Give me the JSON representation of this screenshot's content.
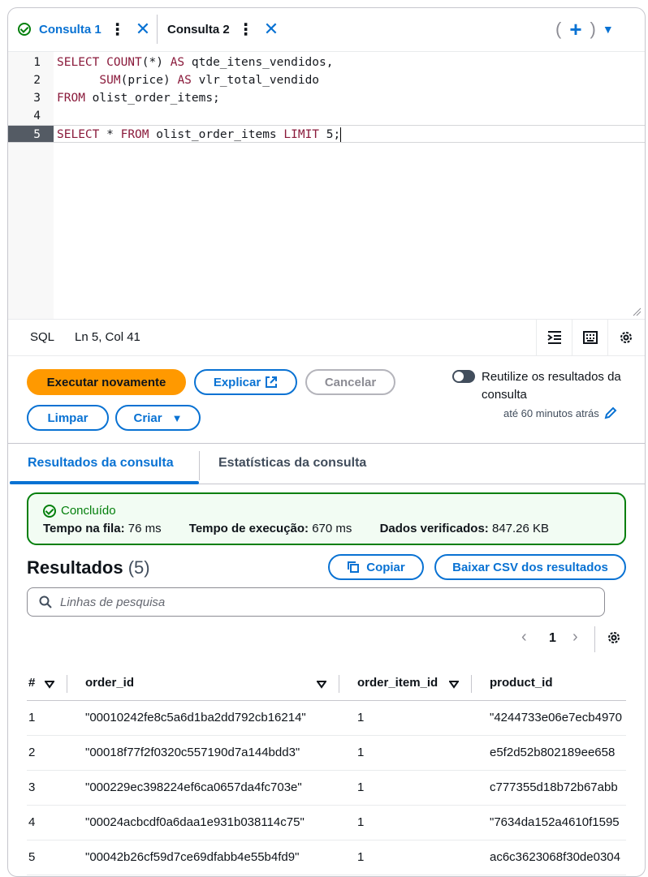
{
  "tabs": [
    {
      "label": "Consulta 1",
      "active": true,
      "status": "success"
    },
    {
      "label": "Consulta 2",
      "active": false
    }
  ],
  "tabs_add": {
    "open": "(",
    "plus": "+",
    "close": ")",
    "caret": "▼"
  },
  "editor": {
    "lines": [
      {
        "num": "1",
        "segments": [
          {
            "t": "SELECT ",
            "kw": true
          },
          {
            "t": "COUNT",
            "kw": true
          },
          {
            "t": "(*) ",
            "kw": false
          },
          {
            "t": "AS",
            "kw": true
          },
          {
            "t": " qtde_itens_vendidos,",
            "kw": false
          }
        ]
      },
      {
        "num": "2",
        "segments": [
          {
            "t": "      ",
            "kw": false
          },
          {
            "t": "SUM",
            "kw": true
          },
          {
            "t": "(price) ",
            "kw": false
          },
          {
            "t": "AS",
            "kw": true
          },
          {
            "t": " vlr_total_vendido",
            "kw": false
          }
        ]
      },
      {
        "num": "3",
        "segments": [
          {
            "t": "FROM",
            "kw": true
          },
          {
            "t": " olist_order_items;",
            "kw": false
          }
        ]
      },
      {
        "num": "4",
        "segments": []
      },
      {
        "num": "5",
        "segments": [
          {
            "t": "SELECT",
            "kw": true
          },
          {
            "t": " * ",
            "kw": false
          },
          {
            "t": "FROM",
            "kw": true
          },
          {
            "t": " olist_order_items ",
            "kw": false
          },
          {
            "t": "LIMIT",
            "kw": true
          },
          {
            "t": " 5;",
            "kw": false
          }
        ]
      }
    ],
    "active_line": 5
  },
  "statusbar": {
    "language": "SQL",
    "position": "Ln 5, Col 41"
  },
  "actions": {
    "run": "Executar novamente",
    "explain": "Explicar",
    "cancel": "Cancelar",
    "clear": "Limpar",
    "create": "Criar",
    "reuse_label": "Reutilize os resultados da consulta",
    "reuse_since": "até 60 minutos atrás"
  },
  "result_tabs": {
    "results": "Resultados da consulta",
    "stats": "Estatísticas da consulta"
  },
  "summary": {
    "status": "Concluído",
    "queue_label": "Tempo na fila:",
    "queue_value": "76 ms",
    "exec_label": "Tempo de execução:",
    "exec_value": "670 ms",
    "scanned_label": "Dados verificados:",
    "scanned_value": "847.26 KB"
  },
  "results": {
    "title": "Resultados",
    "count": "(5)",
    "copy": "Copiar",
    "download": "Baixar CSV dos resultados",
    "search_placeholder": "Linhas de pesquisa",
    "page": "1"
  },
  "table": {
    "columns": [
      "#",
      "order_id",
      "order_item_id",
      "product_id"
    ],
    "rows": [
      [
        "1",
        "\"00010242fe8c5a6d1ba2dd792cb16214\"",
        "1",
        "\"4244733e06e7ecb4970"
      ],
      [
        "2",
        "\"00018f77f2f0320c557190d7a144bdd3\"",
        "1",
        "e5f2d52b802189ee658"
      ],
      [
        "3",
        "\"000229ec398224ef6ca0657da4fc703e\"",
        "1",
        "c777355d18b72b67abb"
      ],
      [
        "4",
        "\"00024acbcdf0a6daa1e931b038114c75\"",
        "1",
        "\"7634da152a4610f1595"
      ],
      [
        "5",
        "\"00042b26cf59d7ce69dfabb4e55b4fd9\"",
        "1",
        "ac6c3623068f30de0304"
      ]
    ]
  },
  "colors": {
    "accent": "#0972d3",
    "primary": "#ff9900",
    "success": "#037f0c",
    "keyword": "#8a1a3b"
  }
}
